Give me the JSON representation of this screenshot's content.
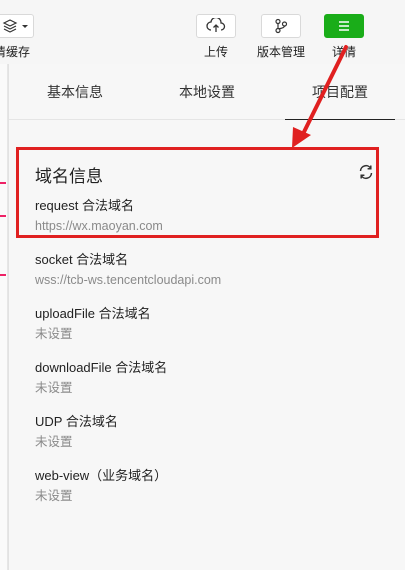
{
  "toolbar": {
    "clear_cache_label": "清缓存",
    "upload_label": "上传",
    "version_label": "版本管理",
    "details_label": "详情"
  },
  "tabs": [
    {
      "label": "基本信息",
      "active": false
    },
    {
      "label": "本地设置",
      "active": false
    },
    {
      "label": "项目配置",
      "active": true
    }
  ],
  "domain_section": {
    "title": "域名信息",
    "items": [
      {
        "label": "request 合法域名",
        "value": "https://wx.maoyan.com"
      },
      {
        "label": "socket 合法域名",
        "value": "wss://tcb-ws.tencentcloudapi.com"
      },
      {
        "label": "uploadFile 合法域名",
        "value": "未设置"
      },
      {
        "label": "downloadFile 合法域名",
        "value": "未设置"
      },
      {
        "label": "UDP 合法域名",
        "value": "未设置"
      },
      {
        "label": "web-view（业务域名）",
        "value": "未设置"
      }
    ]
  },
  "colors": {
    "accent_green": "#1aad19",
    "annotation_red": "#e02020"
  }
}
